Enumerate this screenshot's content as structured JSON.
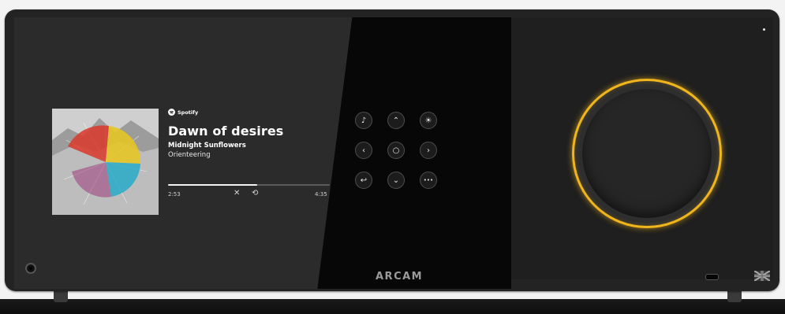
{
  "source": {
    "service": "Spotify",
    "brand_color": "#1DB954"
  },
  "track": {
    "title": "Dawn of desires",
    "artist": "Midnight Sunflowers",
    "album": "Orienteering",
    "elapsed": "2:53",
    "total": "4:35",
    "progress_fraction": 0.55
  },
  "controls": {
    "shuffle_icon": "shuffle-icon",
    "repeat_icon": "repeat-icon",
    "buttons": [
      {
        "name": "music-note-button",
        "glyph": "♪"
      },
      {
        "name": "up-button",
        "glyph": "⌃"
      },
      {
        "name": "brightness-button",
        "glyph": "☀"
      },
      {
        "name": "left-button",
        "glyph": "‹"
      },
      {
        "name": "select-button",
        "glyph": "○"
      },
      {
        "name": "right-button",
        "glyph": "›"
      },
      {
        "name": "back-button",
        "glyph": "↩"
      },
      {
        "name": "down-button",
        "glyph": "⌄"
      },
      {
        "name": "more-button",
        "glyph": "•••"
      }
    ]
  },
  "device": {
    "logo": "ARCAM",
    "accent_color": "#f1b51c"
  }
}
